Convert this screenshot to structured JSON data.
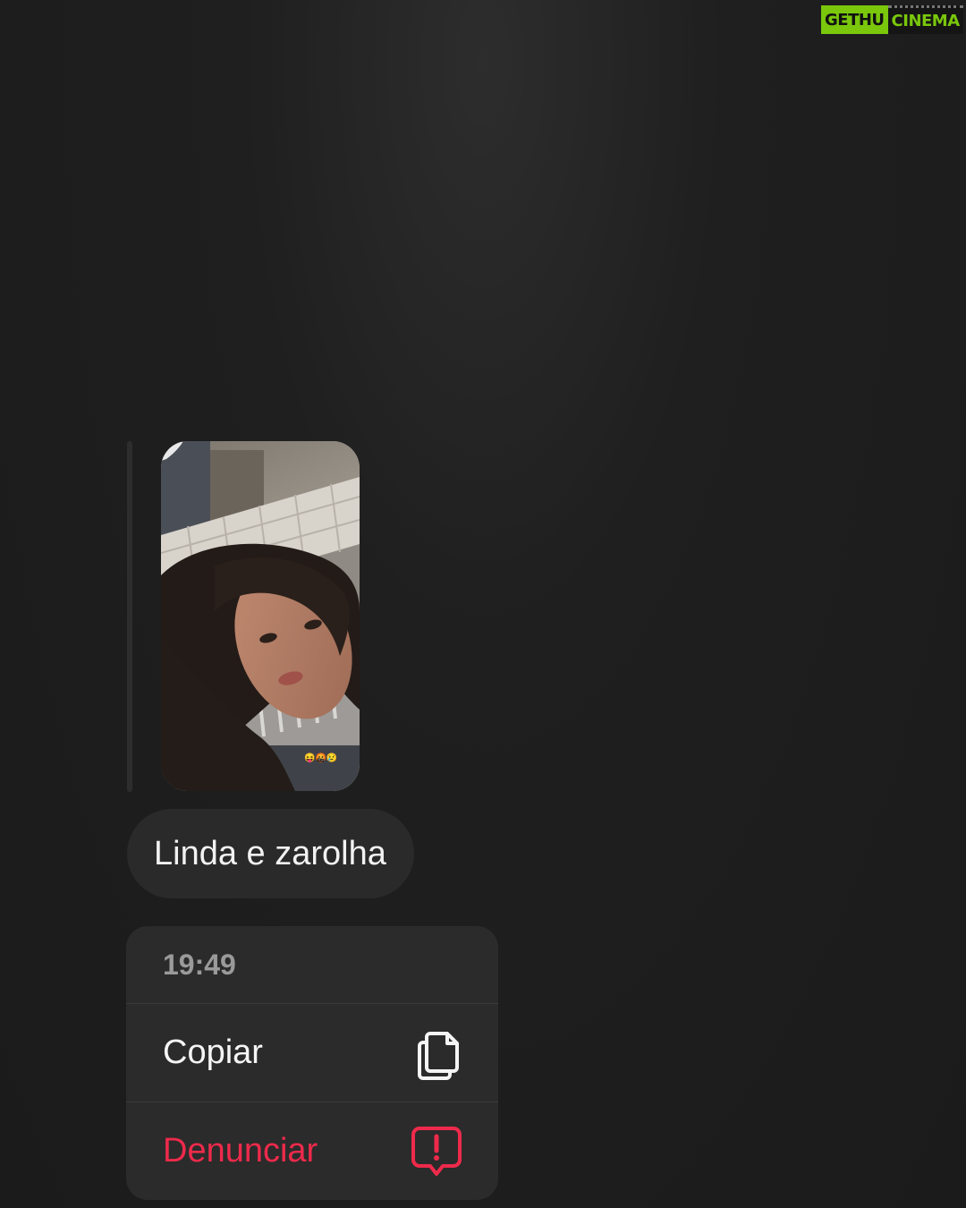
{
  "watermark": {
    "left": "GETHU",
    "right": "CINEMA"
  },
  "story_reply": {
    "image": "selfie-photo",
    "stickers": "😝🤬😢"
  },
  "message": {
    "text": "Linda e zarolha"
  },
  "context_menu": {
    "timestamp": "19:49",
    "items": [
      {
        "label": "Copiar",
        "icon": "copy-icon"
      },
      {
        "label": "Denunciar",
        "icon": "report-icon"
      }
    ]
  },
  "colors": {
    "background": "#1f1f1f",
    "bubble": "#2a2a2a",
    "menu": "#2b2b2b",
    "danger": "#ee2a4b",
    "watermark_green": "#7ac70c"
  }
}
